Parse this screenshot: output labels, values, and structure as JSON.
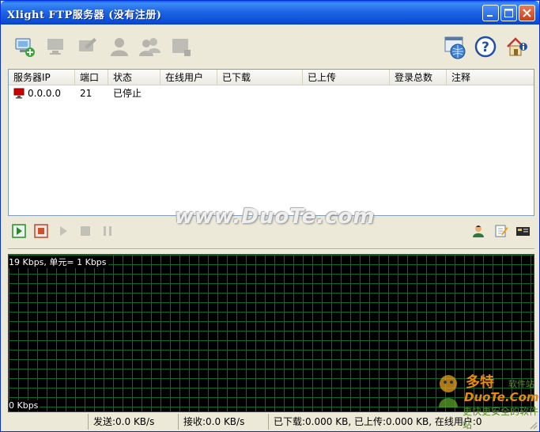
{
  "window": {
    "title": "Xlight FTP服务器 (没有注册)"
  },
  "toolbar": {
    "left_icons": [
      "add-server-icon",
      "remove-server-icon",
      "edit-server-icon",
      "user-icon",
      "group-icon",
      "settings-icon"
    ],
    "right_icons": [
      "global-options-icon",
      "help-icon",
      "home-info-icon"
    ]
  },
  "table": {
    "columns": [
      "服务器IP",
      "端口",
      "状态",
      "在线用户",
      "已下载",
      "已上传",
      "登录总数",
      "注释"
    ],
    "rows": [
      {
        "ip": "0.0.0.0",
        "port": "21",
        "status": "已停止",
        "online": "",
        "downloaded": "",
        "uploaded": "",
        "logins": "",
        "note": ""
      }
    ]
  },
  "controls": {
    "left": [
      "start-icon",
      "stop-icon",
      "play-icon",
      "stop-square-icon",
      "pause-icon"
    ],
    "right": [
      "user-manager-icon",
      "edit-note-icon",
      "log-icon"
    ]
  },
  "graph": {
    "scale_top": "19 Kbps, 单元= 1 Kbps",
    "scale_bottom": "0 Kbps"
  },
  "status": {
    "send": "发送:0.0 KB/s",
    "receive": "接收:0.0 KB/s",
    "transfer": "已下载:0.000 KB, 已上传:0.000 KB, 在线用户:0"
  },
  "watermark": {
    "center": "www.DuoTe.com",
    "logo_line1": "多特",
    "logo_line2": "软件站",
    "logo_line3": "DuoTe.Com",
    "logo_line4": "更快更安全的软件站"
  },
  "colors": {
    "titlebar": "#0a5fe6",
    "graph_bg": "#000000",
    "grid": "#0a6b2a",
    "stopped_icon": "#cc0000"
  }
}
